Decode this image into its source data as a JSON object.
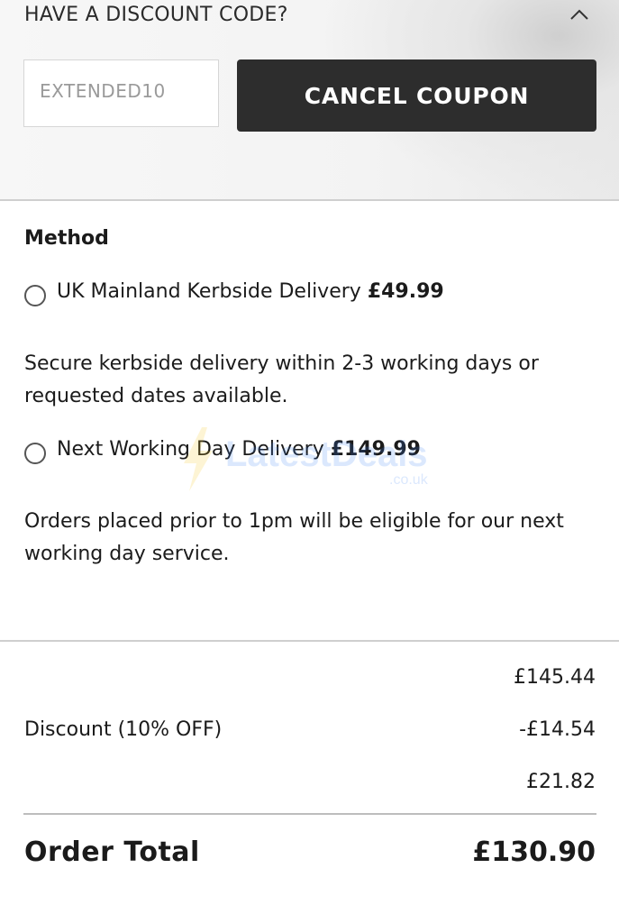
{
  "discount": {
    "header": "HAVE A DISCOUNT CODE?",
    "coupon_value": "EXTENDED10",
    "cancel_label": "CANCEL COUPON"
  },
  "shipping": {
    "method_label": "Method",
    "options": [
      {
        "name": "UK Mainland Kerbside Delivery",
        "price": "£49.99",
        "description": "Secure kerbside delivery within 2-3 working days or requested dates available."
      },
      {
        "name": "Next Working Day Delivery",
        "price": "£149.99",
        "description": "Orders placed prior to 1pm will be eligible for our next working day service."
      }
    ]
  },
  "watermark": {
    "text": "LatestDeals",
    "sub": ".co.uk"
  },
  "summary": {
    "subtotal": "£145.44",
    "discount_label": "Discount (10% OFF)",
    "discount_value": "-£14.54",
    "shipping_value": "£21.82",
    "total_label": "Order Total",
    "total_value": "£130.90"
  }
}
